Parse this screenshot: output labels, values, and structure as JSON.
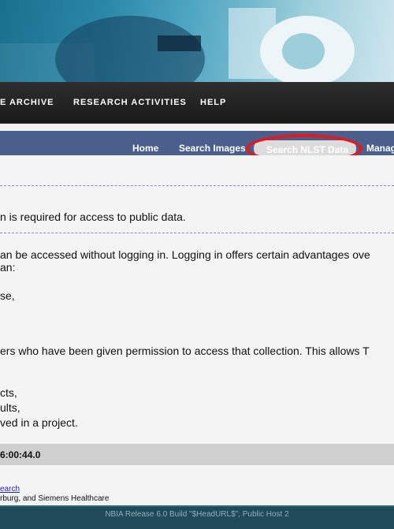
{
  "main_nav": {
    "items": [
      {
        "label": "E ARCHIVE"
      },
      {
        "label": "RESEARCH ACTIVITIES"
      },
      {
        "label": "HELP"
      }
    ]
  },
  "sub_nav": {
    "items": [
      {
        "label": "Home"
      },
      {
        "label": "Search Images"
      },
      {
        "label": "Search NLST Data"
      },
      {
        "label": "Manag"
      }
    ],
    "active": "Search NLST Data"
  },
  "content": {
    "line1": "n is required for access to public data.",
    "line2a": "an be accessed without logging in. Logging in offers certain advantages ove",
    "line2b": "an:",
    "line3": "se,",
    "line4": "ers who have been given permission to access that collection. This allows T",
    "line5a": "cts,",
    "line5b": "ults,",
    "line5c": "ved in a project."
  },
  "timebar": {
    "text": "6:00:44.0"
  },
  "footer": {
    "link": "earch",
    "text": "rburg, and Siemens Healthcare",
    "release": "NBIA Release 6.0 Build \"$HeadURL$\", Public Host 2"
  },
  "colors": {
    "subnav_bg": "#4a5f8c",
    "highlight_ring": "#e5181e",
    "bottom_bar": "#1f4a5a"
  }
}
